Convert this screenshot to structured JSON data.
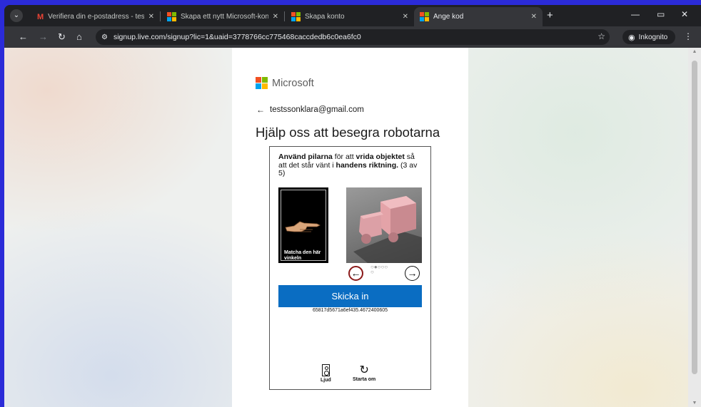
{
  "browser": {
    "tabs": [
      {
        "title": "Verifiera din e-postadress - test",
        "icon": "gmail-icon",
        "active": false
      },
      {
        "title": "Skapa ett nytt Microsoft-konto",
        "icon": "microsoft-icon",
        "active": false
      },
      {
        "title": "Skapa konto",
        "icon": "microsoft-icon",
        "active": false
      },
      {
        "title": "Ange kod",
        "icon": "microsoft-icon",
        "active": true
      }
    ],
    "close_glyph": "✕",
    "new_tab_glyph": "+",
    "url": "signup.live.com/signup?lic=1&uaid=3778766cc775468caccdedb6c0ea6fc0",
    "incognito_label": "Inkognito"
  },
  "page": {
    "brand": "Microsoft",
    "email": "testssonklara@gmail.com",
    "heading": "Hjälp oss att besegra robotarna"
  },
  "captcha": {
    "instr_1": "Använd pilarna",
    "instr_2": " för att ",
    "instr_3": "vrida objektet",
    "instr_4": " så att det står vänt i ",
    "instr_5": "handens riktning.",
    "instr_6": " (3 av 5)",
    "reference_label": "Matcha den här vinkeln",
    "progress_dots": "○●○○○",
    "progress_dots_2": "○",
    "submit_label": "Skicka in",
    "session_id": "65817d5671a6ef435.4672400605",
    "audio_label": "Ljud",
    "restart_label": "Starta om"
  },
  "colors": {
    "accent": "#0a6dc2",
    "ms_red": "#f25022",
    "ms_green": "#7fba00",
    "ms_blue": "#00a4ef",
    "ms_yellow": "#ffb900"
  }
}
